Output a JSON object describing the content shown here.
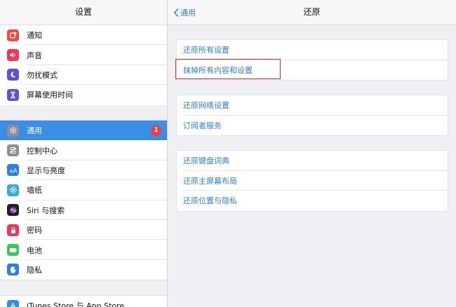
{
  "sidebar": {
    "title": "设置",
    "group1": [
      {
        "label": "通知",
        "icon": "notifications-icon",
        "color": "#f24a3d"
      },
      {
        "label": "声音",
        "icon": "sounds-icon",
        "color": "#f2365a"
      },
      {
        "label": "勿扰模式",
        "icon": "moon-icon",
        "color": "#5b54d6"
      },
      {
        "label": "屏幕使用时间",
        "icon": "hourglass-icon",
        "color": "#5b54d6"
      }
    ],
    "group2": [
      {
        "label": "通用",
        "icon": "gear-icon",
        "color": "#8e8e93",
        "badge": "1",
        "selected": true
      },
      {
        "label": "控制中心",
        "icon": "switches-icon",
        "color": "#8e8e93"
      },
      {
        "label": "显示与亮度",
        "icon": "text-size-icon",
        "color": "#2f7ee0"
      },
      {
        "label": "墙纸",
        "icon": "flower-icon",
        "color": "#35aadc"
      },
      {
        "label": "Siri 与搜索",
        "icon": "siri-icon",
        "color": "#222222"
      },
      {
        "label": "密码",
        "icon": "lock-icon",
        "color": "#f2365a"
      },
      {
        "label": "电池",
        "icon": "battery-icon",
        "color": "#3cc65a"
      },
      {
        "label": "隐私",
        "icon": "hand-icon",
        "color": "#2f7ee0"
      }
    ],
    "group3": [
      {
        "label": "iTunes Store 与 App Store",
        "icon": "app-store-icon",
        "color": "#2f8ff0"
      }
    ]
  },
  "detail": {
    "back_label": "通用",
    "title": "还原",
    "group1": [
      "还原所有设置",
      "抹掉所有内容和设置"
    ],
    "group2": [
      "还原网络设置",
      "订阅者服务"
    ],
    "group3": [
      "还原键盘词典",
      "还原主屏幕布局",
      "还原位置与隐私"
    ]
  },
  "colors": {
    "accent": "#2f7ee0",
    "selected_row": "#3b8ee6",
    "highlight_box": "#e0232f",
    "badge": "#f03b3b"
  }
}
